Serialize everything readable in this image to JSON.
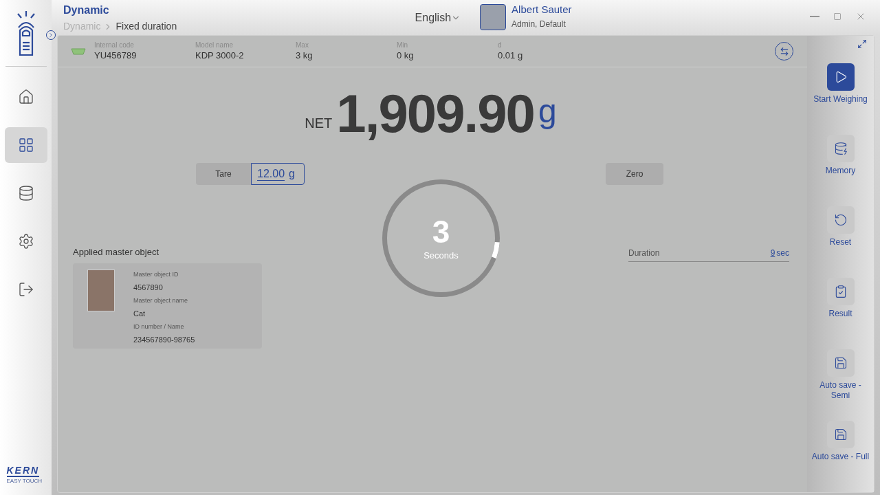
{
  "header": {
    "title": "Dynamic",
    "breadcrumb": [
      {
        "label": "Dynamic",
        "selected": false
      },
      {
        "label": "Fixed duration",
        "selected": true
      }
    ],
    "language": "English",
    "user": {
      "name": "Albert Sauter",
      "role": "Admin, Default"
    }
  },
  "sidebar": {
    "items": [
      {
        "kind": "home",
        "selected": false
      },
      {
        "kind": "dashboard",
        "selected": true
      },
      {
        "kind": "database",
        "selected": false
      },
      {
        "kind": "settings",
        "selected": false
      },
      {
        "kind": "exit",
        "selected": false
      }
    ],
    "logo": {
      "brand": "KERN",
      "tagline": "EASY TOUCH"
    }
  },
  "scale_info": [
    {
      "label": "Internal code",
      "value": "YU456789"
    },
    {
      "label": "Model name",
      "value": "KDP 3000-2"
    },
    {
      "label": "Max",
      "value": "3 kg"
    },
    {
      "label": "Min",
      "value": "0 kg"
    },
    {
      "label": "d",
      "value": "0.01 g"
    }
  ],
  "reading": {
    "prefix": "NET",
    "value": "1,909.90",
    "unit": "g"
  },
  "tare": {
    "label": "Tare",
    "value": "12.00",
    "unit": "g"
  },
  "zero": {
    "label": "Zero"
  },
  "countdown": {
    "value": "3",
    "label": "Seconds"
  },
  "duration": {
    "label": "Duration",
    "value": "9",
    "unit": "sec"
  },
  "master_object": {
    "title": "Applied master object",
    "fields": [
      {
        "label": "Master object ID",
        "value": "4567890"
      },
      {
        "label": "Master object name",
        "value": "Cat"
      },
      {
        "label": "ID number / Name",
        "value": "234567890-98765"
      }
    ]
  },
  "actions": [
    {
      "kind": "play",
      "label": "Start Weighing",
      "selected": true
    },
    {
      "kind": "memory",
      "label": "Memory",
      "selected": false
    },
    {
      "kind": "reset",
      "label": "Reset",
      "selected": false
    },
    {
      "kind": "result",
      "label": "Result",
      "selected": false
    },
    {
      "kind": "save",
      "label": "Auto save - Semi",
      "selected": false
    },
    {
      "kind": "save",
      "label": "Auto save - Full",
      "selected": false
    }
  ]
}
